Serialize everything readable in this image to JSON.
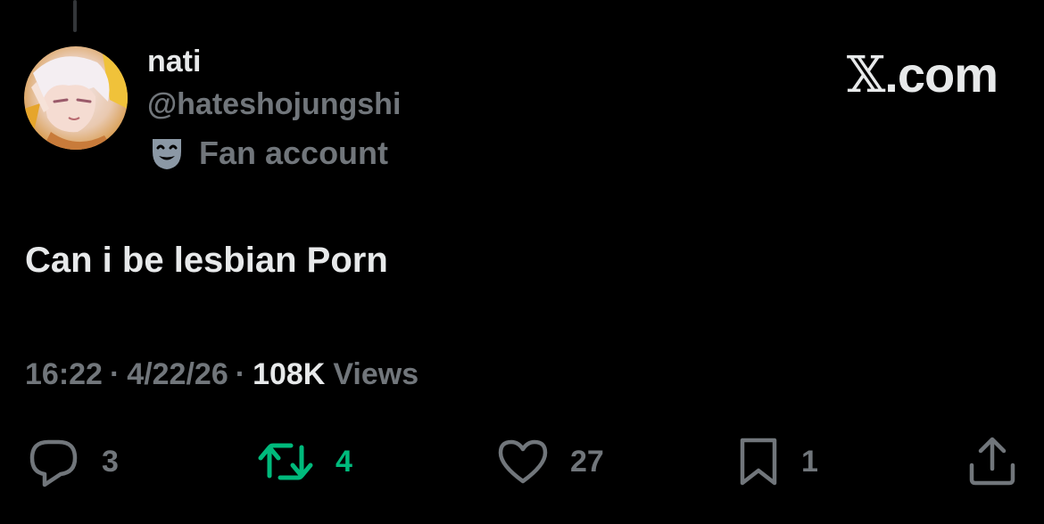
{
  "author": {
    "display_name": "nati",
    "handle": "@hateshojungshi",
    "label_icon": "theater-mask-icon",
    "label_text": "Fan account",
    "avatar": "anime-character-avatar"
  },
  "brand": {
    "logo_mark": "𝕏",
    "domain_suffix": ".com"
  },
  "tweet": {
    "text": "Can i be lesbian Porn"
  },
  "meta": {
    "time": "16:22",
    "separator": "·",
    "date": "4/22/26",
    "views_count": "108K",
    "views_label": "Views"
  },
  "actions": {
    "reply": {
      "icon": "reply-icon",
      "count": "3"
    },
    "retweet": {
      "icon": "retweet-icon",
      "count": "4",
      "active": true
    },
    "like": {
      "icon": "heart-icon",
      "count": "27"
    },
    "bookmark": {
      "icon": "bookmark-icon",
      "count": "1"
    },
    "share": {
      "icon": "share-icon"
    }
  },
  "colors": {
    "background": "#000000",
    "primary_text": "#e7e9ea",
    "secondary_text": "#71767b",
    "retweet_active": "#00ba7c",
    "label_icon": "#8b98a5"
  }
}
